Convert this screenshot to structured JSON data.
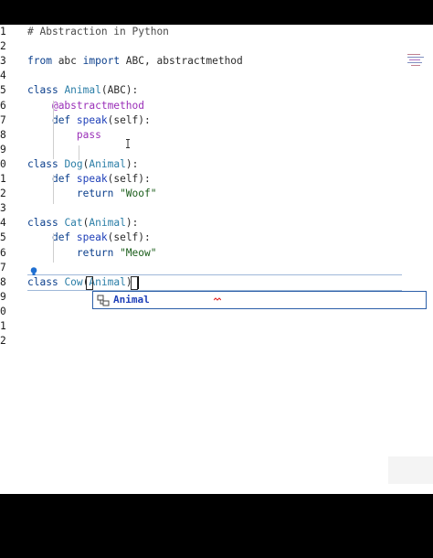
{
  "editor": {
    "lines": [
      {
        "n": "1",
        "tokens": [
          {
            "t": "# Abstraction in Python",
            "c": "cmt"
          }
        ]
      },
      {
        "n": "2",
        "tokens": []
      },
      {
        "n": "3",
        "tokens": [
          {
            "t": "from",
            "c": "kw"
          },
          {
            "t": " abc ",
            "c": ""
          },
          {
            "t": "import",
            "c": "kw"
          },
          {
            "t": " ABC, abstractmethod",
            "c": ""
          }
        ]
      },
      {
        "n": "4",
        "tokens": []
      },
      {
        "n": "5",
        "tokens": [
          {
            "t": "class",
            "c": "kw"
          },
          {
            "t": " ",
            "c": ""
          },
          {
            "t": "Animal",
            "c": "cls"
          },
          {
            "t": "(ABC):",
            "c": ""
          }
        ]
      },
      {
        "n": "6",
        "tokens": [
          {
            "t": "    ",
            "c": ""
          },
          {
            "t": "@abstractmethod",
            "c": "deco"
          }
        ]
      },
      {
        "n": "7",
        "tokens": [
          {
            "t": "    ",
            "c": ""
          },
          {
            "t": "def",
            "c": "kw"
          },
          {
            "t": " ",
            "c": ""
          },
          {
            "t": "speak",
            "c": "fn"
          },
          {
            "t": "(self):",
            "c": ""
          }
        ]
      },
      {
        "n": "8",
        "tokens": [
          {
            "t": "        ",
            "c": ""
          },
          {
            "t": "pass",
            "c": "deco"
          }
        ]
      },
      {
        "n": "9",
        "tokens": []
      },
      {
        "n": "0",
        "tokens": [
          {
            "t": "class",
            "c": "kw"
          },
          {
            "t": " ",
            "c": ""
          },
          {
            "t": "Dog",
            "c": "cls"
          },
          {
            "t": "(",
            "c": ""
          },
          {
            "t": "Animal",
            "c": "cls"
          },
          {
            "t": "):",
            "c": ""
          }
        ]
      },
      {
        "n": "1",
        "tokens": [
          {
            "t": "    ",
            "c": ""
          },
          {
            "t": "def",
            "c": "kw"
          },
          {
            "t": " ",
            "c": ""
          },
          {
            "t": "speak",
            "c": "fn"
          },
          {
            "t": "(self):",
            "c": ""
          }
        ]
      },
      {
        "n": "2",
        "tokens": [
          {
            "t": "        ",
            "c": ""
          },
          {
            "t": "return",
            "c": "kw"
          },
          {
            "t": " ",
            "c": ""
          },
          {
            "t": "\"Woof\"",
            "c": "str"
          }
        ]
      },
      {
        "n": "3",
        "tokens": []
      },
      {
        "n": "4",
        "tokens": [
          {
            "t": "class",
            "c": "kw"
          },
          {
            "t": " ",
            "c": ""
          },
          {
            "t": "Cat",
            "c": "cls"
          },
          {
            "t": "(",
            "c": ""
          },
          {
            "t": "Animal",
            "c": "cls"
          },
          {
            "t": "):",
            "c": ""
          }
        ]
      },
      {
        "n": "5",
        "tokens": [
          {
            "t": "    ",
            "c": ""
          },
          {
            "t": "def",
            "c": "kw"
          },
          {
            "t": " ",
            "c": ""
          },
          {
            "t": "speak",
            "c": "fn"
          },
          {
            "t": "(self):",
            "c": ""
          }
        ]
      },
      {
        "n": "6",
        "tokens": [
          {
            "t": "        ",
            "c": ""
          },
          {
            "t": "return",
            "c": "kw"
          },
          {
            "t": " ",
            "c": ""
          },
          {
            "t": "\"Meow\"",
            "c": "str"
          }
        ]
      },
      {
        "n": "7",
        "tokens": []
      },
      {
        "n": "8",
        "tokens": [
          {
            "t": "class",
            "c": "kw"
          },
          {
            "t": " ",
            "c": ""
          },
          {
            "t": "Cow",
            "c": "cls"
          },
          {
            "t": "(",
            "c": ""
          },
          {
            "t": "Animal",
            "c": "cls"
          },
          {
            "t": ")",
            "c": ""
          }
        ]
      },
      {
        "n": "9",
        "tokens": []
      },
      {
        "n": "0",
        "tokens": []
      },
      {
        "n": "1",
        "tokens": []
      },
      {
        "n": "2",
        "tokens": []
      }
    ]
  },
  "autocomplete": {
    "items": [
      {
        "label": "Animal",
        "icon": "class-symbol-icon"
      }
    ]
  },
  "colors": {
    "keyword": "#0b3f8c",
    "class_name": "#2b7ea7",
    "function": "#1e3fb8",
    "decorator": "#9a2fb8",
    "string": "#1a5d1a",
    "selection_border": "#2c5fa8"
  }
}
